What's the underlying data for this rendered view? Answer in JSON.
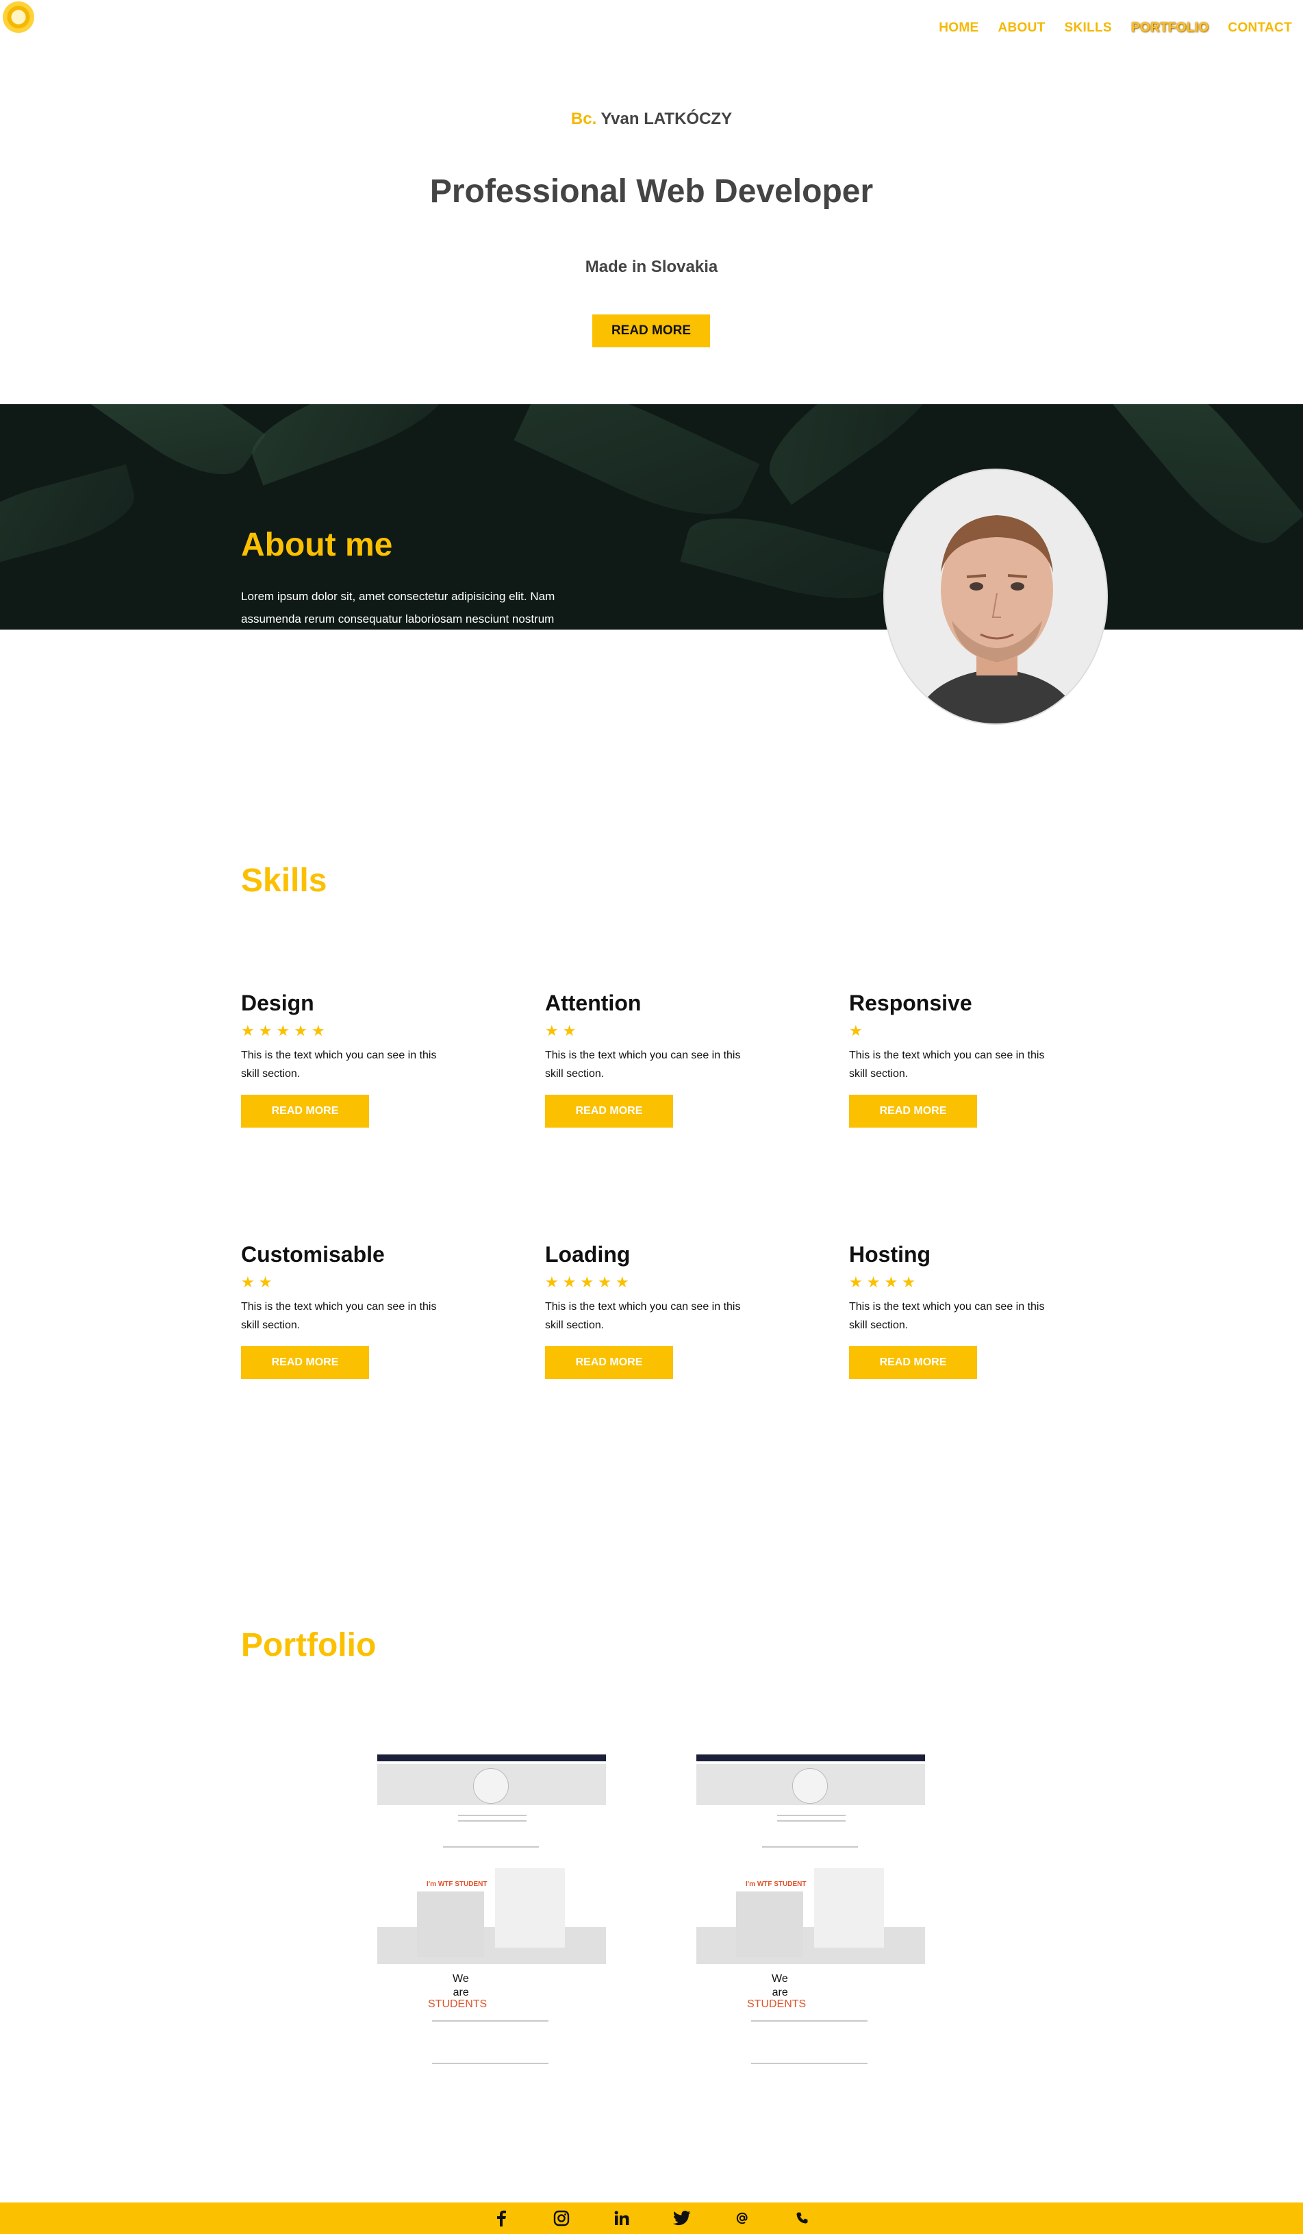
{
  "nav": {
    "items": [
      "HOME",
      "ABOUT",
      "SKILLS",
      "PORTFOLIO",
      "CONTACT"
    ],
    "active": "PORTFOLIO"
  },
  "hero": {
    "title_prefix": "Bc.",
    "name": "Yvan LATKÓCZY",
    "headline": "Professional Web Developer",
    "subheadline": "Made in Slovakia",
    "button_label": "READ MORE"
  },
  "about": {
    "title": "About me",
    "text": "Lorem ipsum dolor sit, amet consectetur adipisicing elit. Nam assumenda rerum consequatur laboriosam nesciunt nostrum temporibus consequuntur"
  },
  "skills": {
    "title": "Skills",
    "items": [
      {
        "name": "Design",
        "stars": 5,
        "text": "This is the text which you can see in this skill section.",
        "button": "READ MORE"
      },
      {
        "name": "Attention",
        "stars": 2,
        "text": "This is the text which you can see in this skill section.",
        "button": "READ MORE"
      },
      {
        "name": "Responsive",
        "stars": 1,
        "text": "This is the text which you can see in this skill section.",
        "button": "READ MORE"
      },
      {
        "name": "Customisable",
        "stars": 2,
        "text": "This is the text which you can see in this skill section.",
        "button": "READ MORE"
      },
      {
        "name": "Loading",
        "stars": 5,
        "text": "This is the text which you can see in this skill section.",
        "button": "READ MORE"
      },
      {
        "name": "Hosting",
        "stars": 4,
        "text": "This is the text which you can see in this skill section.",
        "button": "READ MORE"
      }
    ]
  },
  "portfolio": {
    "title": "Portfolio",
    "thumb": {
      "student_label": "I'm WTF STUDENT",
      "we": "We",
      "are": "are",
      "students": "STUDENTS"
    }
  },
  "footer": {
    "icons": [
      "facebook-icon",
      "instagram-icon",
      "linkedin-icon",
      "twitter-icon",
      "email-icon",
      "phone-icon"
    ]
  },
  "colors": {
    "accent": "#fbc000",
    "text": "#444444",
    "footer": "#fbc000"
  }
}
